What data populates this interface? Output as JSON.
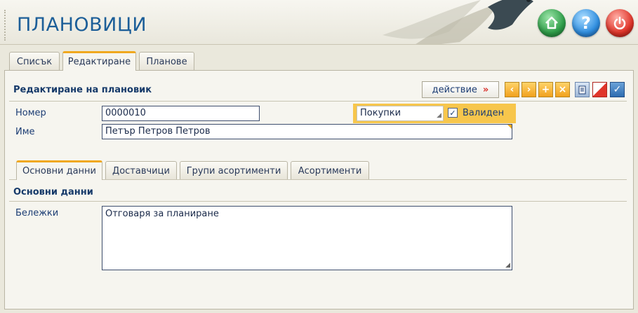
{
  "app": {
    "title": "ПЛАНОВИЦИ"
  },
  "header_buttons": {
    "home": "home-icon",
    "help": "?",
    "power": "power-icon"
  },
  "main_tabs": [
    {
      "label": "Списък"
    },
    {
      "label": "Редактиране"
    },
    {
      "label": "Планове"
    }
  ],
  "form": {
    "title": "Редактиране на плановик",
    "action_label": "действие",
    "action_arrow": "»",
    "toolbar": [
      "chevron-left-icon",
      "chevron-right-icon",
      "plus-icon",
      "delete-x-icon",
      "print-icon",
      "clear-icon",
      "confirm-check-icon"
    ],
    "number_label": "Номер",
    "number_value": "0000010",
    "name_label": "Име",
    "name_value": "Петър Петров Петров",
    "type_value": "Покупки",
    "valid_label": "Валиден",
    "valid_checked": true
  },
  "sub_tabs": [
    {
      "label": "Основни данни"
    },
    {
      "label": "Доставчици"
    },
    {
      "label": "Групи асортименти"
    },
    {
      "label": "Асортименти"
    }
  ],
  "basic": {
    "title": "Основни данни",
    "notes_label": "Бележки",
    "notes_value": "Отговаря за планиране"
  },
  "colors": {
    "accent": "#f0a81e",
    "title_blue": "#1c5e98",
    "background": "#eae8dc"
  }
}
